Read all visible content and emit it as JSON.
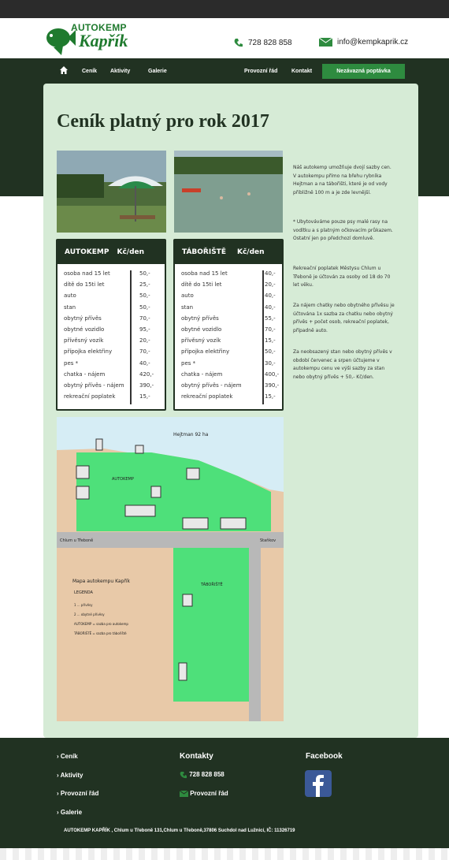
{
  "logo": {
    "line1": "AUTOKEMP",
    "line2": "Kapřík"
  },
  "header": {
    "phone": "728 828 858",
    "email": "info@kempkaprik.cz"
  },
  "nav": {
    "items": [
      "Ceník",
      "Aktivity",
      "Galerie"
    ],
    "right_items": [
      "Provozní řád",
      "Kontakt"
    ],
    "cta": "Nezávazná poptávka"
  },
  "page": {
    "title": "Ceník platný pro rok 2017"
  },
  "autokemp": {
    "header": "AUTOKEMP",
    "currency": "Kč/den",
    "rows": [
      [
        "osoba nad 15 let",
        "50,-"
      ],
      [
        "dítě do 15ti let",
        "25,-"
      ],
      [
        "auto",
        "50,-"
      ],
      [
        "stan",
        "50,-"
      ],
      [
        "obytný přívěs",
        "70,-"
      ],
      [
        "obytné vozidlo",
        "95,-"
      ],
      [
        "přívěsný vozík",
        "20,-"
      ],
      [
        "přípojka elektřiny",
        "70,-"
      ],
      [
        "pes *",
        "40,-"
      ],
      [
        "chatka - nájem",
        "420,-"
      ],
      [
        "obytný přívěs - nájem",
        "390,-"
      ],
      [
        "rekreační poplatek",
        "15,-"
      ]
    ]
  },
  "taboriste": {
    "header": "TÁBOŘIŠTĚ",
    "currency": "Kč/den",
    "rows": [
      [
        "osoba nad 15 let",
        "40,-"
      ],
      [
        "dítě do 15ti let",
        "20,-"
      ],
      [
        "auto",
        "40,-"
      ],
      [
        "stan",
        "40,-"
      ],
      [
        "obytný přívěs",
        "55,-"
      ],
      [
        "obytné vozidlo",
        "70,-"
      ],
      [
        "přívěsný vozík",
        "15,-"
      ],
      [
        "přípojka elektřiny",
        "50,-"
      ],
      [
        "pes *",
        "30,-"
      ],
      [
        "chatka - nájem",
        "400,-"
      ],
      [
        "obytný přívěs - nájem",
        "390,-"
      ],
      [
        "rekreační poplatek",
        "15,-"
      ]
    ]
  },
  "side": {
    "p1": "Náš autokemp umožňuje dvojí sazby cen. V autokempu přímo na břehu rybníka Hejtman a na tábořišti, které je od vody přibližně 100 m a je zde levnější.",
    "p2": "* Ubytováváme pouze psy malé rasy na vodítku a s platným očkovacím průkazem. Ostatní jen po předchozí domluvě.",
    "p3": "Rekreační poplatek Městysu Chlum u Třeboně je účtován za osoby od 18 do 70 let věku.",
    "p4": "Za nájem chatky nebo obytného přívěsu je účtována 1x sazba za chatku nebo obytný přívěs + počet osob, rekreační poplatek, případně auto.",
    "p5": "Za neobsazený stan nebo obytný přívěs v období červenec a srpen účtujeme v autokempu cenu ve výši sazby za stan nebo obytný přívěs + 50,- Kč/den."
  },
  "map": {
    "lake": "Hejtman 92 ha",
    "autokemp_label": "AUTOKEMP",
    "taboriste_label": "TÁBOŘIŠTĚ",
    "road_left": "Chlum u Třeboně",
    "road_right": "Staňkov",
    "legend_title": "Mapa autokempu Kapřík",
    "legend": "LEGENDA",
    "legend_lines": [
      "1 ... přívěsy",
      "2 ... obytné přívěsy",
      "AUTOKEMP = sazba pro autokemp",
      "TÁBOŘIŠTĚ = sazba pro tábořiště"
    ]
  },
  "footer": {
    "links": [
      "Ceník",
      "Aktivity",
      "Provozní řád",
      "Galerie"
    ],
    "contacts_title": "Kontakty",
    "phone": "728 828 858",
    "rules": "Provozní řád",
    "facebook_title": "Facebook",
    "copyright": "AUTOKEMP KAPŘÍK , Chlum u Třeboně 131,Chlum u Třeboně,37806 Suchdol nad Lužnicí, IČ: 11326719"
  },
  "colors": {
    "dark": "#213222",
    "accent": "#2e8b3f",
    "panel": "#d6ebd6"
  }
}
